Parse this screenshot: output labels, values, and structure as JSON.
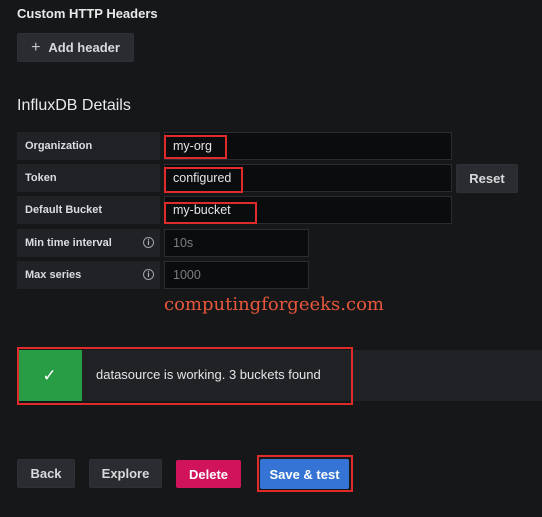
{
  "custom_headers": {
    "title": "Custom HTTP Headers",
    "add_button": {
      "icon": "plus-icon",
      "label": "Add header"
    }
  },
  "influx": {
    "title": "InfluxDB Details",
    "organization": {
      "label": "Organization",
      "value": "my-org"
    },
    "token": {
      "label": "Token",
      "value": "configured",
      "reset_label": "Reset"
    },
    "default_bucket": {
      "label": "Default Bucket",
      "value": "my-bucket"
    },
    "min_time_interval": {
      "label": "Min time interval",
      "placeholder": "10s",
      "info_icon": "info-circle-icon"
    },
    "max_series": {
      "label": "Max series",
      "placeholder": "1000",
      "info_icon": "info-circle-icon"
    }
  },
  "watermark": "computingforgeeks.com",
  "alert": {
    "icon": "check-icon",
    "message": "datasource is working. 3 buckets found"
  },
  "actions": {
    "back": "Back",
    "explore": "Explore",
    "delete": "Delete",
    "save_test": "Save & test"
  },
  "colors": {
    "success": "#299c46",
    "danger": "#d1135b",
    "primary": "#3574d4",
    "highlight": "#e02b2b",
    "watermark": "#e8573c"
  }
}
